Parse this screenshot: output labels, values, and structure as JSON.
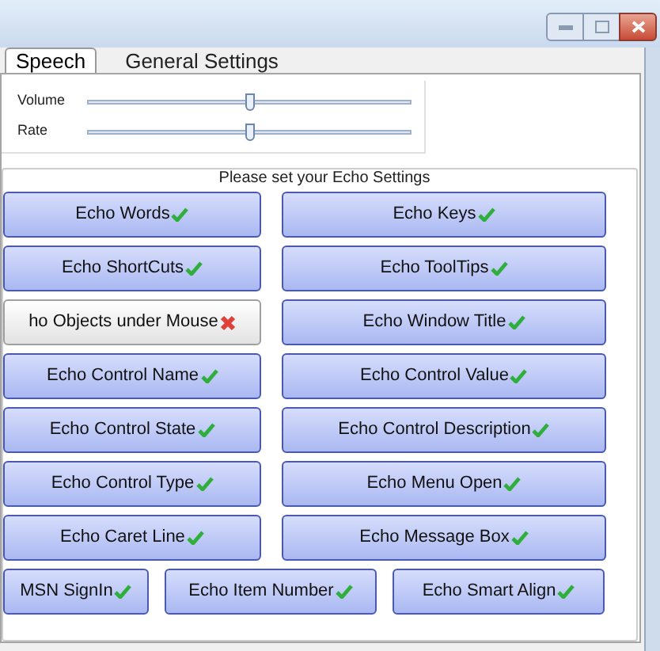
{
  "tabs": [
    {
      "label": "Speech",
      "selected": true
    },
    {
      "label": "General Settings",
      "selected": false
    }
  ],
  "sliders": [
    {
      "label": "Volume",
      "level": 0.5
    },
    {
      "label": "Rate",
      "level": 0.5
    }
  ],
  "echo_settings": {
    "title": "Please set your Echo Settings",
    "rows": [
      [
        {
          "label": "Echo Words",
          "on": true
        },
        {
          "label": "Echo Keys",
          "on": true
        }
      ],
      [
        {
          "label": "Echo ShortCuts",
          "on": true
        },
        {
          "label": "Echo ToolTips",
          "on": true
        }
      ],
      [
        {
          "label": "ho Objects under Mouse",
          "on": false
        },
        {
          "label": "Echo Window Title",
          "on": true
        }
      ],
      [
        {
          "label": "Echo Control Name",
          "on": true
        },
        {
          "label": "Echo Control Value",
          "on": true
        }
      ],
      [
        {
          "label": "Echo Control State",
          "on": true
        },
        {
          "label": "Echo Control Description",
          "on": true
        }
      ],
      [
        {
          "label": "Echo Control Type",
          "on": true
        },
        {
          "label": "Echo Menu Open",
          "on": true
        }
      ],
      [
        {
          "label": "Echo Caret Line",
          "on": true
        },
        {
          "label": "Echo Message Box",
          "on": true
        }
      ],
      [
        {
          "label": "MSN SignIn",
          "on": true
        },
        {
          "label": "Echo Item Number",
          "on": true
        },
        {
          "label": "Echo Smart Align",
          "on": true
        }
      ]
    ]
  }
}
